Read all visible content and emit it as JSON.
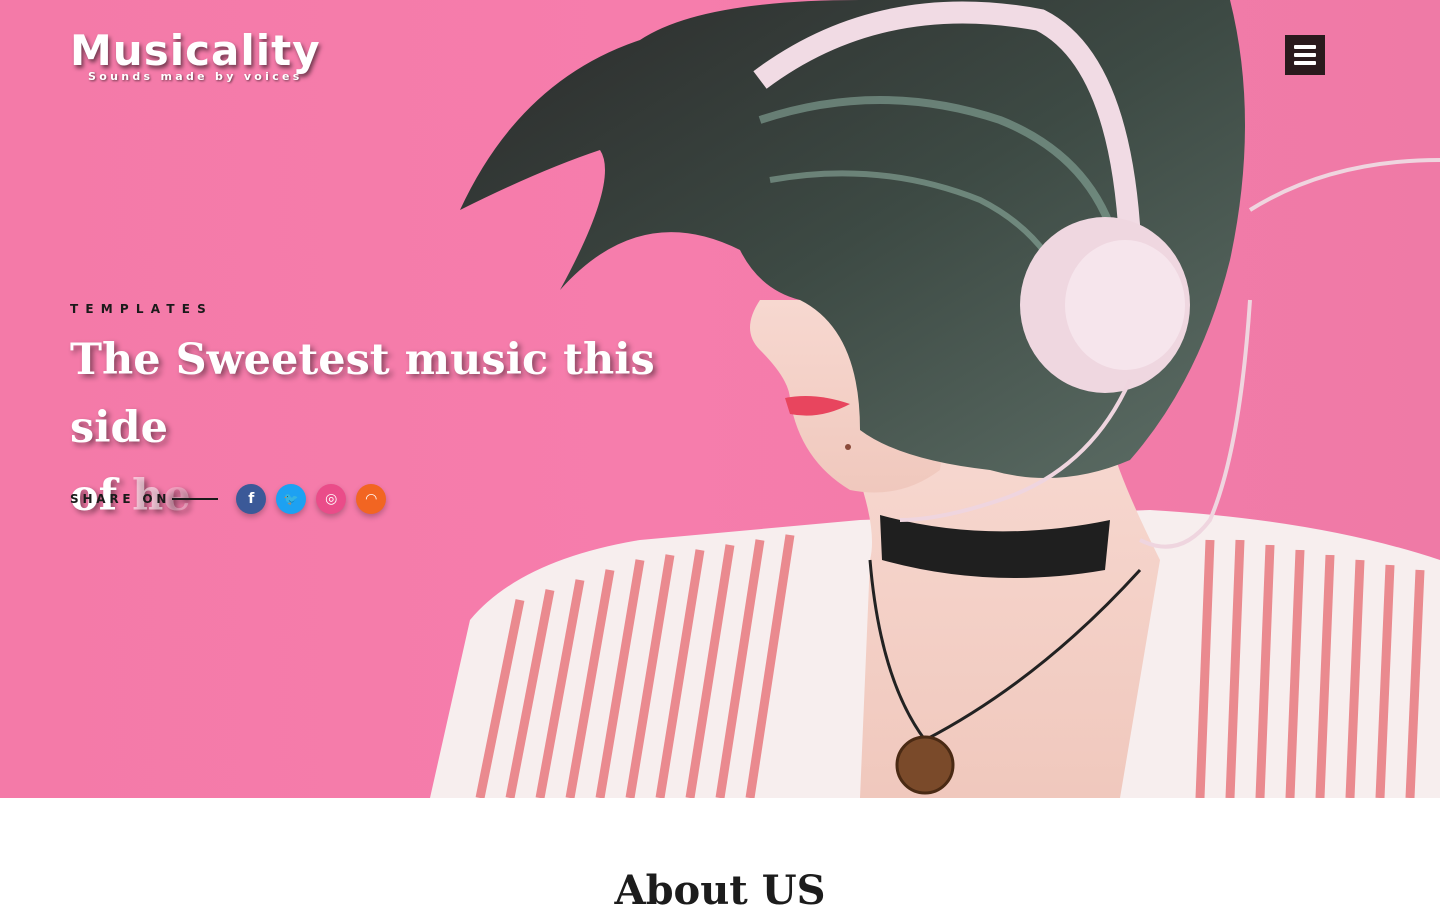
{
  "brand": {
    "title": "Musicality",
    "tagline": "Sounds made by voices"
  },
  "nav": {
    "menu_icon": "hamburger-menu-icon"
  },
  "hero": {
    "eyebrow": "TEMPLATES",
    "headline_line1": "The Sweetest music this side",
    "headline_line2_solid": "of ",
    "headline_line2_fading_1": "h",
    "headline_line2_fading_2": "e",
    "background_color": "#f47aa8",
    "share": {
      "label": "SHARE ON",
      "icons": [
        {
          "name": "facebook-icon",
          "glyph": "f",
          "color": "#3b5998"
        },
        {
          "name": "twitter-icon",
          "glyph": "🐦",
          "color": "#1da1f2"
        },
        {
          "name": "dribbble-icon",
          "glyph": "◎",
          "color": "#ea4c89"
        },
        {
          "name": "rss-icon",
          "glyph": "◠",
          "color": "#f26522"
        }
      ]
    }
  },
  "about": {
    "title": "About US"
  }
}
